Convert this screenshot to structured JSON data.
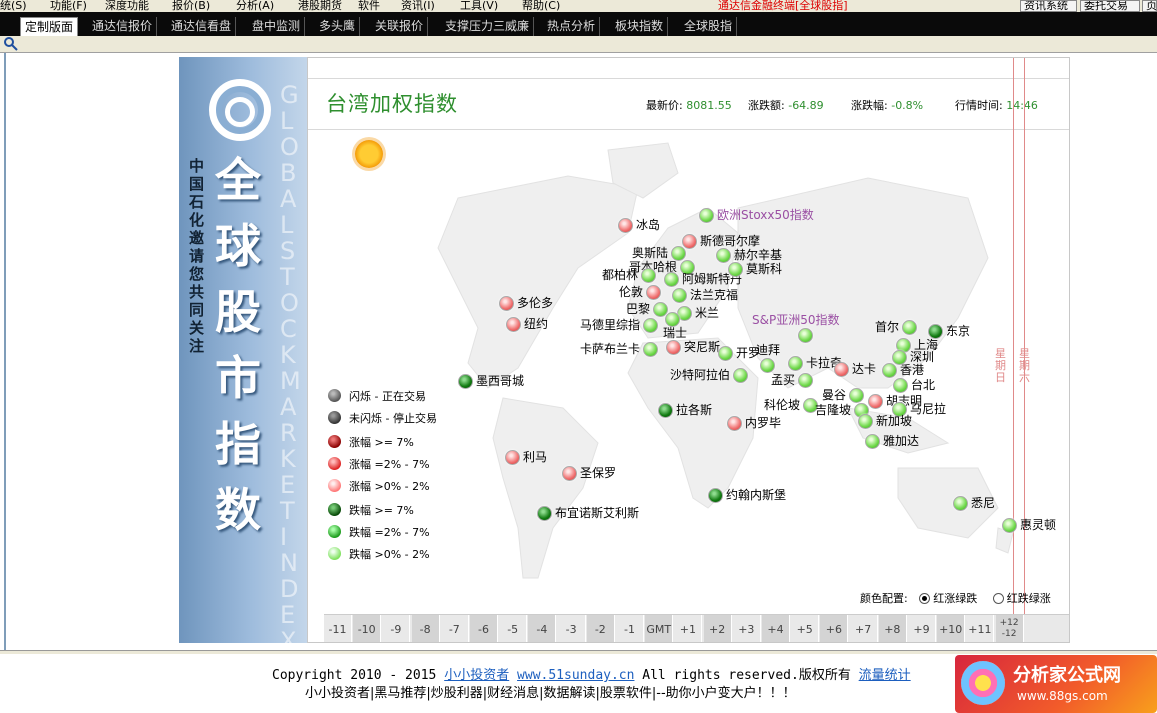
{
  "menubar": {
    "items": [
      "统(S)",
      "功能(F)",
      "深度功能",
      "报价(B)",
      "分析(A)",
      "港股期货",
      "软件",
      "资讯(I)",
      "工具(V)",
      "帮助(C)"
    ],
    "notice": "通达信金融终端[全球股指]",
    "right_buttons": [
      "资讯系统",
      "委托交易",
      "页"
    ]
  },
  "tabs": [
    "定制版面",
    "通达信报价",
    "通达信看盘",
    "盘中监测",
    "多头鹰",
    "关联报价",
    "支撑压力三威廉",
    "热点分析",
    "板块指数",
    "全球股指"
  ],
  "active_tab": "定制版面",
  "sidebar": {
    "title_big": "全球股市指数",
    "title_small": "中国石化邀请您共同关注",
    "vertical_en": "GLOBAL STOCK MARKET INDEX"
  },
  "map": {
    "title": "台湾加权指数",
    "latest_label": "最新价:",
    "latest_value": "8081.55",
    "change_label": "涨跌额:",
    "change_value": "-64.89",
    "pct_label": "涨跌幅:",
    "pct_value": "-0.8%",
    "time_label": "行情时间:",
    "time_value": "14:46",
    "date_labels": [
      "星期日",
      "星期六"
    ]
  },
  "cities": [
    {
      "name": "冰岛",
      "color": "pr",
      "special": false
    },
    {
      "name": "欧洲Stoxx50指数",
      "color": "lg",
      "special": true
    },
    {
      "name": "斯德哥尔摩",
      "color": "pr",
      "special": false
    },
    {
      "name": "奥斯陆",
      "color": "lg",
      "special": false
    },
    {
      "name": "赫尔辛基",
      "color": "lg",
      "special": false
    },
    {
      "name": "哥本哈根",
      "color": "lg",
      "special": false
    },
    {
      "name": "都柏林",
      "color": "lg",
      "special": false
    },
    {
      "name": "阿姆斯特丹",
      "color": "lg",
      "special": false
    },
    {
      "name": "莫斯科",
      "color": "lg",
      "special": false
    },
    {
      "name": "伦敦",
      "color": "pr",
      "special": false
    },
    {
      "name": "法兰克福",
      "color": "lg",
      "special": false
    },
    {
      "name": "巴黎",
      "color": "lg",
      "special": false
    },
    {
      "name": "米兰",
      "color": "lg",
      "special": false
    },
    {
      "name": "瑞士",
      "color": "lg",
      "special": false
    },
    {
      "name": "马德里综指",
      "color": "lg",
      "special": false
    },
    {
      "name": "卡萨布兰卡",
      "color": "lg",
      "special": false
    },
    {
      "name": "突尼斯",
      "color": "pr",
      "special": false
    },
    {
      "name": "开罗",
      "color": "lg",
      "special": false
    },
    {
      "name": "沙特阿拉伯",
      "color": "lg",
      "special": false
    },
    {
      "name": "迪拜",
      "color": "lg",
      "special": false
    },
    {
      "name": "卡拉奇",
      "color": "lg",
      "special": false
    },
    {
      "name": "孟买",
      "color": "lg",
      "special": false
    },
    {
      "name": "达卡",
      "color": "pr",
      "special": false
    },
    {
      "name": "S&P亚洲50指数",
      "color": "lg",
      "special": true
    },
    {
      "name": "首尔",
      "color": "lg",
      "special": false
    },
    {
      "name": "东京",
      "color": "dg",
      "special": false
    },
    {
      "name": "上海",
      "color": "lg",
      "special": false
    },
    {
      "name": "深圳",
      "color": "lg",
      "special": false
    },
    {
      "name": "香港",
      "color": "lg",
      "special": false
    },
    {
      "name": "台北",
      "color": "lg",
      "special": false
    },
    {
      "name": "曼谷",
      "color": "lg",
      "special": false
    },
    {
      "name": "胡志明",
      "color": "pr",
      "special": false
    },
    {
      "name": "科伦坡",
      "color": "lg",
      "special": false
    },
    {
      "name": "吉隆坡",
      "color": "lg",
      "special": false
    },
    {
      "name": "马尼拉",
      "color": "lg",
      "special": false
    },
    {
      "name": "新加坡",
      "color": "lg",
      "special": false
    },
    {
      "name": "雅加达",
      "color": "lg",
      "special": false
    },
    {
      "name": "悉尼",
      "color": "lg",
      "special": false
    },
    {
      "name": "惠灵顿",
      "color": "lg",
      "special": false
    },
    {
      "name": "多伦多",
      "color": "pr",
      "special": false
    },
    {
      "name": "纽约",
      "color": "pr",
      "special": false
    },
    {
      "name": "墨西哥城",
      "color": "dg",
      "special": false
    },
    {
      "name": "利马",
      "color": "pr",
      "special": false
    },
    {
      "name": "圣保罗",
      "color": "pr",
      "special": false
    },
    {
      "name": "布宜诺斯艾利斯",
      "color": "dg",
      "special": false
    },
    {
      "name": "拉各斯",
      "color": "dg",
      "special": false
    },
    {
      "name": "内罗毕",
      "color": "pr",
      "special": false
    },
    {
      "name": "约翰内斯堡",
      "color": "dg",
      "special": false
    }
  ],
  "legend": [
    {
      "dot": "ld-gray",
      "text": "闪烁 - 正在交易"
    },
    {
      "dot": "ld-dgray",
      "text": "未闪烁 - 停止交易"
    },
    {
      "dot": "ld-dr",
      "text": "涨幅 >= 7%"
    },
    {
      "dot": "ld-mr",
      "text": "涨幅 =2% - 7%"
    },
    {
      "dot": "ld-lr",
      "text": "涨幅 >0% - 2%"
    },
    {
      "dot": "ld-dg",
      "text": "跌幅 >= 7%"
    },
    {
      "dot": "ld-mg",
      "text": "跌幅 =2% - 7%"
    },
    {
      "dot": "ld-lg",
      "text": "跌幅 >0% - 2%"
    }
  ],
  "color_config": {
    "label": "颜色配置:",
    "option1": "红涨绿跌",
    "option2": "红跌绿涨",
    "selected": "红涨绿跌"
  },
  "timezones": [
    "-11",
    "-10",
    "-9",
    "-8",
    "-7",
    "-6",
    "-5",
    "-4",
    "-3",
    "-2",
    "-1",
    "GMT",
    "+1",
    "+2",
    "+3",
    "+4",
    "+5",
    "+6",
    "+7",
    "+8",
    "+9",
    "+10",
    "+11",
    "+12 -12"
  ],
  "footer": {
    "copyright_pre": "Copyright 2010 - 2015",
    "link1": "小小投资者",
    "link2": "www.51sunday.cn",
    "copyright_post": "All rights reserved.版权所有",
    "link3": "流量统计",
    "line2": "小小投资者|黑马推荐|炒股利器|财经消息|数据解读|股票软件|--助你小户变大户！！！"
  },
  "badge": {
    "title": "分析家公式网",
    "url": "www.88gs.com"
  }
}
